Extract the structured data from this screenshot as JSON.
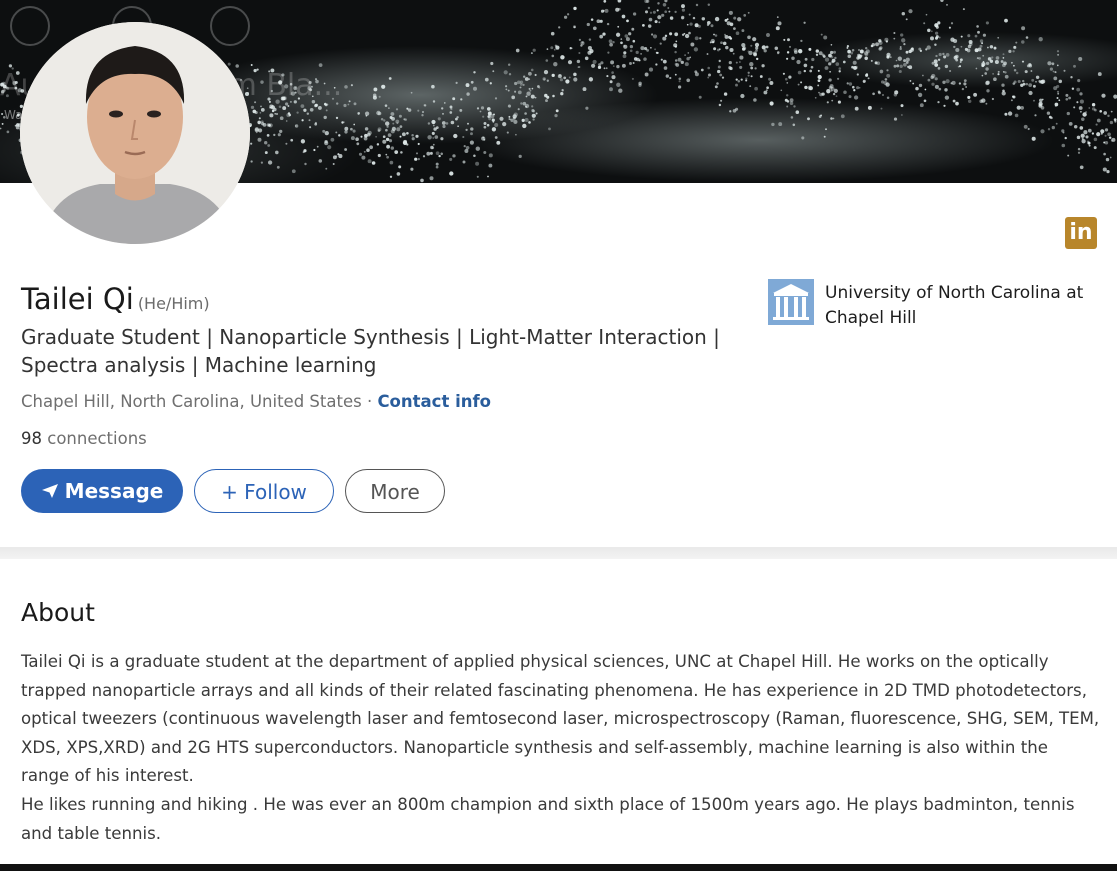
{
  "banner": {
    "overlay_title": "Audien & William Bla...",
    "overlay_subtitle": "WaveMusic"
  },
  "profile": {
    "name": "Tailei Qi",
    "pronouns": "(He/Him)",
    "headline": "Graduate Student | Nanoparticle Synthesis | Light-Matter Interaction | Spectra analysis | Machine learning",
    "location": "Chapel Hill, North Carolina, United States",
    "location_separator": " · ",
    "contact_label": "Contact info",
    "connections_count": "98",
    "connections_label": " connections"
  },
  "actions": {
    "message_label": "Message",
    "message_icon": "send-icon",
    "follow_label": "+ Follow",
    "more_label": "More"
  },
  "education": {
    "school": "University of North Carolina at Chapel Hill"
  },
  "brand": {
    "logo_text": "in",
    "accent_color": "#2c63b7"
  },
  "about": {
    "title": "About",
    "paragraph_1": "Tailei Qi is a graduate student at the department of applied physical sciences, UNC at Chapel Hill. He works on the optically trapped nanoparticle arrays and all kinds of their related fascinating phenomena. He has experience in 2D TMD photodetectors, optical tweezers (continuous wavelength laser and femtosecond laser, microspectroscopy (Raman, fluorescence, SHG, SEM, TEM, XDS, XPS,XRD) and 2G HTS superconductors. Nanoparticle synthesis and self-assembly, machine learning is also within the range of his interest.",
    "paragraph_2": "He likes running and hiking . He was ever an 800m champion and sixth place of 1500m years ago. He plays badminton, tennis and table tennis."
  }
}
